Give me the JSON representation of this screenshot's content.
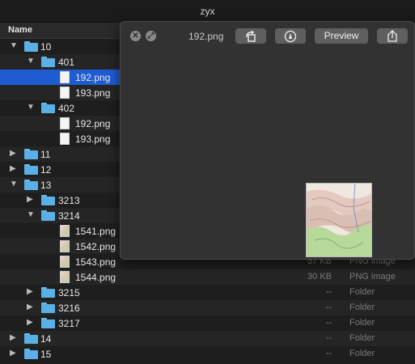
{
  "window": {
    "title": "zyx"
  },
  "header": {
    "name_col": "Name"
  },
  "rows": [
    {
      "type": "folder",
      "name": "10",
      "expanded": true,
      "size": "",
      "kind": ""
    },
    {
      "type": "folder",
      "name": "401",
      "expanded": true,
      "size": "",
      "kind": ""
    },
    {
      "type": "file",
      "name": "192.png",
      "size": "",
      "kind": "",
      "selected": true
    },
    {
      "type": "file",
      "name": "193.png",
      "size": "",
      "kind": ""
    },
    {
      "type": "folder",
      "name": "402",
      "expanded": true,
      "size": "",
      "kind": ""
    },
    {
      "type": "file",
      "name": "192.png",
      "size": "",
      "kind": ""
    },
    {
      "type": "file",
      "name": "193.png",
      "size": "",
      "kind": ""
    },
    {
      "type": "folder",
      "name": "11",
      "expanded": false,
      "size": "",
      "kind": ""
    },
    {
      "type": "folder",
      "name": "12",
      "expanded": false,
      "size": "",
      "kind": ""
    },
    {
      "type": "folder",
      "name": "13",
      "expanded": true,
      "size": "",
      "kind": ""
    },
    {
      "type": "folder",
      "name": "3213",
      "expanded": false,
      "size": "",
      "kind": ""
    },
    {
      "type": "folder",
      "name": "3214",
      "expanded": true,
      "size": "",
      "kind": ""
    },
    {
      "type": "file",
      "name": "1541.png",
      "size": "",
      "kind": ""
    },
    {
      "type": "file",
      "name": "1542.png",
      "size": "",
      "kind": ""
    },
    {
      "type": "file",
      "name": "1543.png",
      "size": "57 KB",
      "kind": "PNG image"
    },
    {
      "type": "file",
      "name": "1544.png",
      "size": "30 KB",
      "kind": "PNG image"
    },
    {
      "type": "folder",
      "name": "3215",
      "expanded": false,
      "size": "--",
      "kind": "Folder"
    },
    {
      "type": "folder",
      "name": "3216",
      "expanded": false,
      "size": "--",
      "kind": "Folder"
    },
    {
      "type": "folder",
      "name": "3217",
      "expanded": false,
      "size": "--",
      "kind": "Folder"
    },
    {
      "type": "folder",
      "name": "14",
      "expanded": false,
      "size": "--",
      "kind": "Folder"
    },
    {
      "type": "folder",
      "name": "15",
      "expanded": false,
      "size": "--",
      "kind": "Folder"
    }
  ],
  "quicklook": {
    "filename": "192.png",
    "preview_label": "Preview",
    "icons": [
      "close-icon",
      "fullscreen-icon",
      "rotate-icon",
      "markup-icon",
      "share-icon"
    ]
  }
}
